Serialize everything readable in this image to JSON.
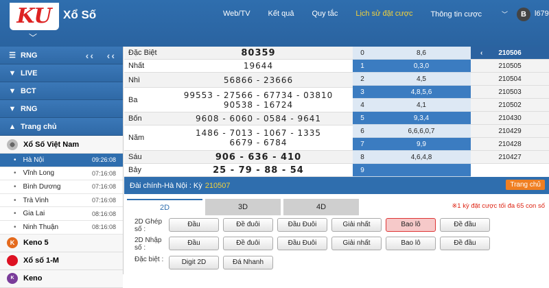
{
  "header": {
    "logo": "KU",
    "brand": "Xổ Số",
    "nav": [
      "Web/TV",
      "Kết quả",
      "Quy tắc",
      "Lịch sử đặt cược",
      "Thông tin cược"
    ],
    "nav_active_index": 3,
    "user_initial": "B",
    "user_id": "l679"
  },
  "sidebar": {
    "groups": [
      {
        "label": "RNG",
        "icon": "menu-icon"
      },
      {
        "label": "LIVE",
        "icon": "chevron-down-icon"
      },
      {
        "label": "BCT",
        "icon": "chevron-down-icon"
      },
      {
        "label": "RNG",
        "icon": "chevron-down-icon"
      },
      {
        "label": "Trang chủ",
        "icon": "chevron-up-icon"
      }
    ],
    "section_vn": "Xổ Số Việt Nam",
    "cities": [
      {
        "name": "Hà Nội",
        "time": "09:26:08"
      },
      {
        "name": "Vĩnh Long",
        "time": "07:16:08"
      },
      {
        "name": "Bình Dương",
        "time": "07:16:08"
      },
      {
        "name": "Trà Vinh",
        "time": "07:16:08"
      },
      {
        "name": "Gia Lai",
        "time": "08:16:08"
      },
      {
        "name": "Ninh Thuận",
        "time": "08:16:08"
      }
    ],
    "keno5": "Keno 5",
    "xs1m": "Xổ số 1-M",
    "keno": "Keno"
  },
  "results": [
    {
      "label": "Đặc Biệt",
      "values": [
        "80359"
      ]
    },
    {
      "label": "Nhất",
      "values": [
        "19644"
      ]
    },
    {
      "label": "Nhì",
      "values": [
        "56866 - 23666"
      ]
    },
    {
      "label": "Ba",
      "values": [
        "99553 - 27566 - 67734 - 03810",
        "90538 - 16724"
      ]
    },
    {
      "label": "Bốn",
      "values": [
        "9608 - 6060 - 0584 - 9641"
      ]
    },
    {
      "label": "Năm",
      "values": [
        "1486 - 7013 - 1067 - 1335",
        "6679 - 6784"
      ]
    },
    {
      "label": "Sáu",
      "values": [
        "906 - 636 - 410"
      ]
    },
    {
      "label": "Bảy",
      "values": [
        "25 - 79 - 88 - 54"
      ]
    }
  ],
  "stats": [
    {
      "n": "0",
      "v": "8,6"
    },
    {
      "n": "1",
      "v": "0,3,0"
    },
    {
      "n": "2",
      "v": "4,5"
    },
    {
      "n": "3",
      "v": "4,8,5,6"
    },
    {
      "n": "4",
      "v": "4,1"
    },
    {
      "n": "5",
      "v": "9,3,4"
    },
    {
      "n": "6",
      "v": "6,6,6,0,7"
    },
    {
      "n": "7",
      "v": "9,9"
    },
    {
      "n": "8",
      "v": "4,6,4,8"
    },
    {
      "n": "9",
      "v": ""
    }
  ],
  "draws": [
    "210506",
    "210505",
    "210504",
    "210503",
    "210502",
    "210430",
    "210429",
    "210428",
    "210427"
  ],
  "infobar": {
    "text": "Đài chính-Hà Nội : Kỳ",
    "num": "210507",
    "home": "Trang chủ"
  },
  "tabs": [
    "2D",
    "3D",
    "4D"
  ],
  "note": "1 kỳ đặt cược tối đa 65 con số",
  "bet_rows": [
    {
      "label": "2D Ghép số :",
      "buttons": [
        "Đầu",
        "Đề đuôi",
        "Đầu Đuôi",
        "Giải nhất",
        "Bao lô",
        "Đề đầu"
      ],
      "active": 4
    },
    {
      "label": "2D Nhập số :",
      "buttons": [
        "Đầu",
        "Đề đuôi",
        "Đầu Đuôi",
        "Giải nhất",
        "Bao lô",
        "Đề đầu"
      ],
      "active": -1
    },
    {
      "label": "Đặc biệt :",
      "buttons": [
        "Digit 2D",
        "Đá Nhanh"
      ],
      "active": -1
    }
  ]
}
